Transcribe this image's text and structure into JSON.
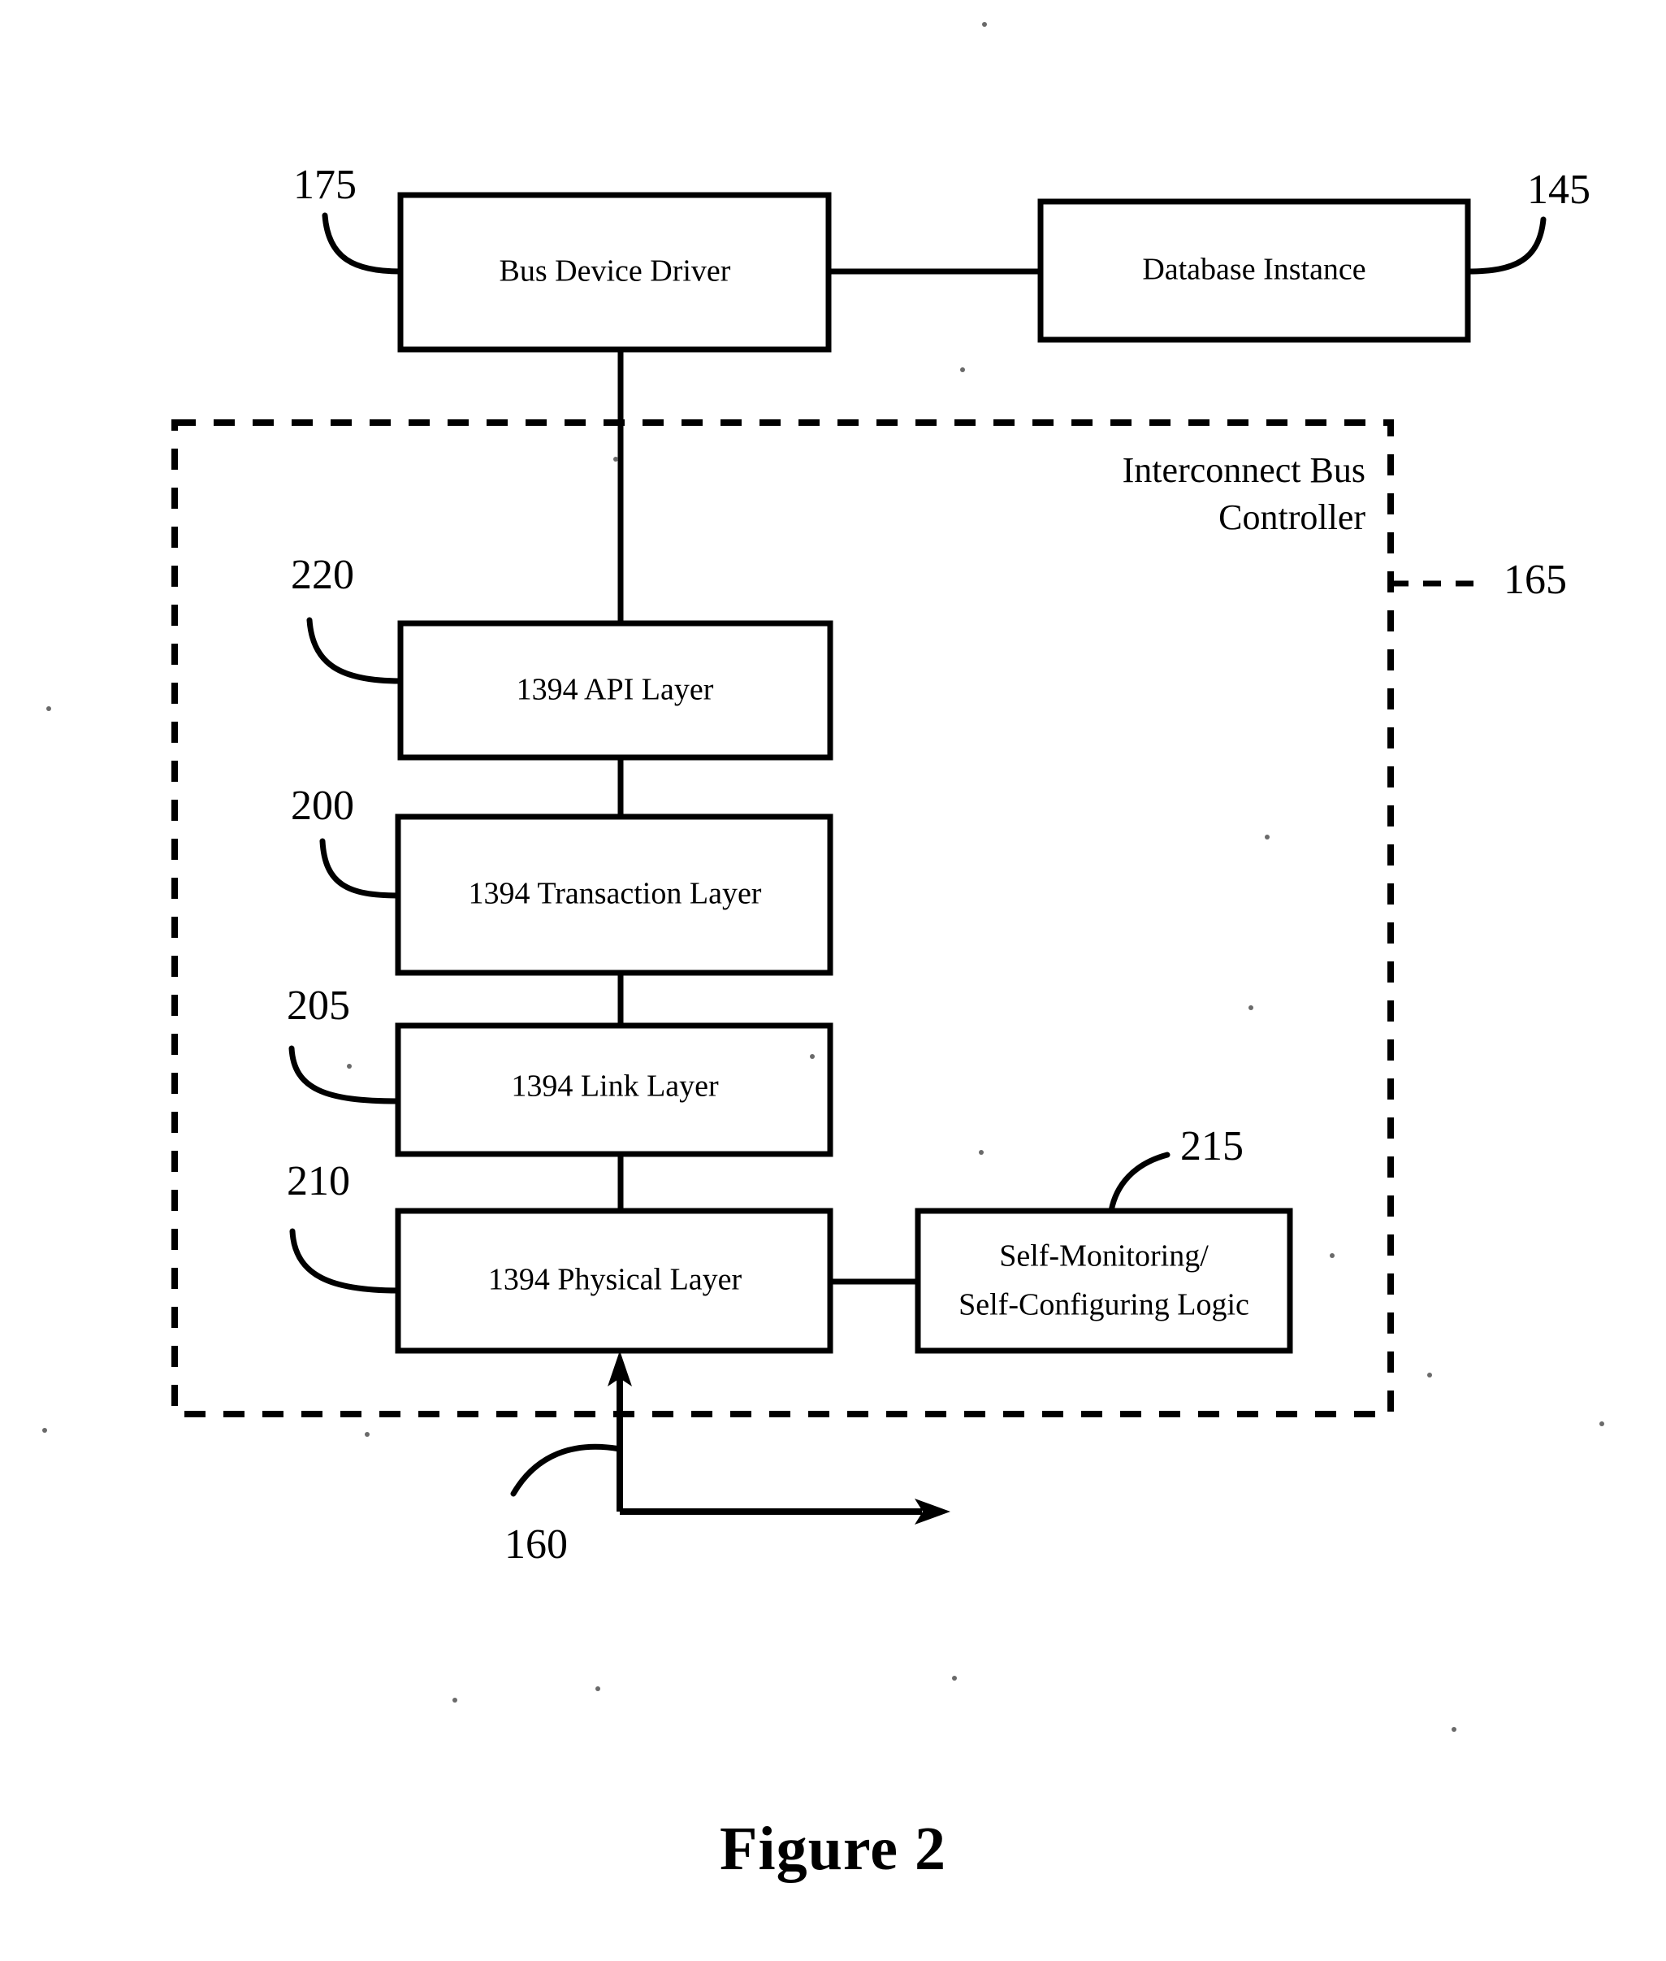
{
  "figure": {
    "caption": "Figure 2"
  },
  "boxes": {
    "bus_device_driver": {
      "label": "Bus Device Driver"
    },
    "database_instance": {
      "label": "Database Instance"
    },
    "api_layer": {
      "label": "1394 API Layer"
    },
    "transaction_layer": {
      "label": "1394 Transaction Layer"
    },
    "link_layer": {
      "label": "1394 Link Layer"
    },
    "physical_layer": {
      "label": "1394 Physical Layer"
    },
    "self_logic": {
      "label_line1": "Self-Monitoring/",
      "label_line2": "Self-Configuring Logic"
    }
  },
  "regions": {
    "interconnect_bus_controller": {
      "label_line1": "Interconnect Bus",
      "label_line2": "Controller"
    }
  },
  "reference_numerals": {
    "bus_device_driver": "175",
    "database_instance": "145",
    "interconnect_bus_controller": "165",
    "api_layer": "220",
    "transaction_layer": "200",
    "link_layer": "205",
    "physical_layer": "210",
    "self_logic": "215",
    "bus_line": "160"
  },
  "colors": {
    "ink": "#000000",
    "paper": "#ffffff"
  }
}
